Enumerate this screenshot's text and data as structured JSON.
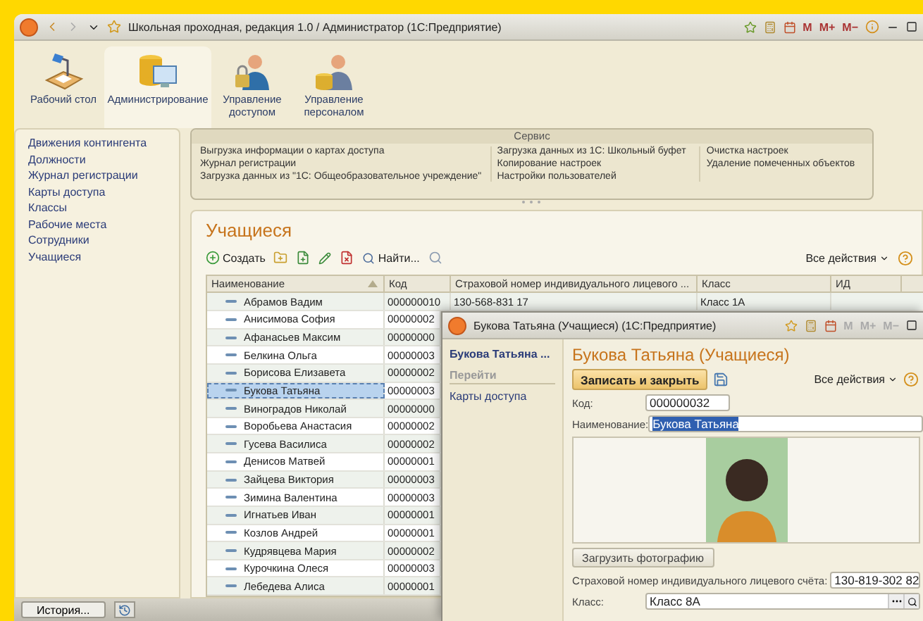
{
  "window": {
    "title": "Школьная проходная, редакция 1.0 / Администратор  (1С:Предприятие)",
    "memory_buttons": [
      "M",
      "M+",
      "M−"
    ]
  },
  "sections": [
    {
      "kind": "desk",
      "label": "Рабочий стол",
      "selected": false
    },
    {
      "kind": "admin",
      "label": "Администрирование",
      "selected": true
    },
    {
      "kind": "access",
      "label": "Управление доступом",
      "selected": false
    },
    {
      "kind": "staff",
      "label": "Управление персоналом",
      "selected": false
    }
  ],
  "nav": {
    "items": [
      "Движения контингента",
      "Должности",
      "Журнал регистрации",
      "Карты доступа",
      "Классы",
      "Рабочие места",
      "Сотрудники",
      "Учащиеся"
    ]
  },
  "service": {
    "title": "Сервис",
    "columns": [
      [
        "Выгрузка информации о картах доступа",
        "Журнал регистрации",
        "Загрузка данных из \"1С: Общеобразовательное учреждение\""
      ],
      [
        "Загрузка данных из 1С: Школьный буфет",
        "Копирование настроек",
        "Настройки пользователей"
      ],
      [
        "Очистка настроек",
        "Удаление помеченных объектов"
      ]
    ]
  },
  "list": {
    "title": "Учащиеся",
    "create": "Создать",
    "find": "Найти...",
    "all_actions": "Все действия",
    "columns": [
      "Наименование",
      "Код",
      "Страховой номер индивидуального лицевого ...",
      "Класс",
      "ИД"
    ],
    "rows": [
      {
        "cells": [
          "Абрамов Вадим",
          "000000010",
          "130-568-831 17",
          "Класс 1А"
        ],
        "selected": false
      },
      {
        "cells": [
          "Анисимова София",
          "00000002"
        ],
        "selected": false
      },
      {
        "cells": [
          "Афанасьев Максим",
          "00000000"
        ],
        "selected": false
      },
      {
        "cells": [
          "Белкина Ольга",
          "00000003"
        ],
        "selected": false
      },
      {
        "cells": [
          "Борисова Елизавета",
          "00000002"
        ],
        "selected": false
      },
      {
        "cells": [
          "Букова Татьяна",
          "00000003"
        ],
        "selected": true
      },
      {
        "cells": [
          "Виноградов Николай",
          "00000000"
        ],
        "selected": false
      },
      {
        "cells": [
          "Воробьева Анастасия",
          "00000002"
        ],
        "selected": false
      },
      {
        "cells": [
          "Гусева Василиса",
          "00000002"
        ],
        "selected": false
      },
      {
        "cells": [
          "Денисов Матвей",
          "00000001"
        ],
        "selected": false
      },
      {
        "cells": [
          "Зайцева Виктория",
          "00000003"
        ],
        "selected": false
      },
      {
        "cells": [
          "Зимина Валентина",
          "00000003"
        ],
        "selected": false
      },
      {
        "cells": [
          "Игнатьев Иван",
          "00000001"
        ],
        "selected": false
      },
      {
        "cells": [
          "Козлов Андрей",
          "00000001"
        ],
        "selected": false
      },
      {
        "cells": [
          "Кудрявцева Мария",
          "00000002"
        ],
        "selected": false
      },
      {
        "cells": [
          "Курочкина Олеся",
          "00000003"
        ],
        "selected": false
      },
      {
        "cells": [
          "Лебедева Алиса",
          "00000001"
        ],
        "selected": false
      }
    ]
  },
  "taskbar": {
    "history": "История..."
  },
  "dialog": {
    "title": "Букова Татьяна (Учащиеся)  (1С:Предприятие)",
    "memory_buttons": [
      "M",
      "M+",
      "M−"
    ],
    "side_title": "Букова Татьяна ...",
    "goto": "Перейти",
    "links": [
      "Карты доступа"
    ],
    "heading": "Букова Татьяна (Учащиеся)",
    "save_close": "Записать и закрыть",
    "all_actions": "Все действия",
    "fields": [
      {
        "kind": "short",
        "label": "Код:",
        "value": "000000032",
        "text_selected": false
      },
      {
        "kind": "wide",
        "label": "Наименование:",
        "value": "Букова Татьяна",
        "text_selected": true
      }
    ],
    "load_photo": "Загрузить фотографию",
    "snils": {
      "label": "Страховой номер индивидуального лицевого счёта:",
      "value": "130-819-302 82"
    },
    "class_field": {
      "label": "Класс:",
      "value": "Класс 8А"
    }
  }
}
